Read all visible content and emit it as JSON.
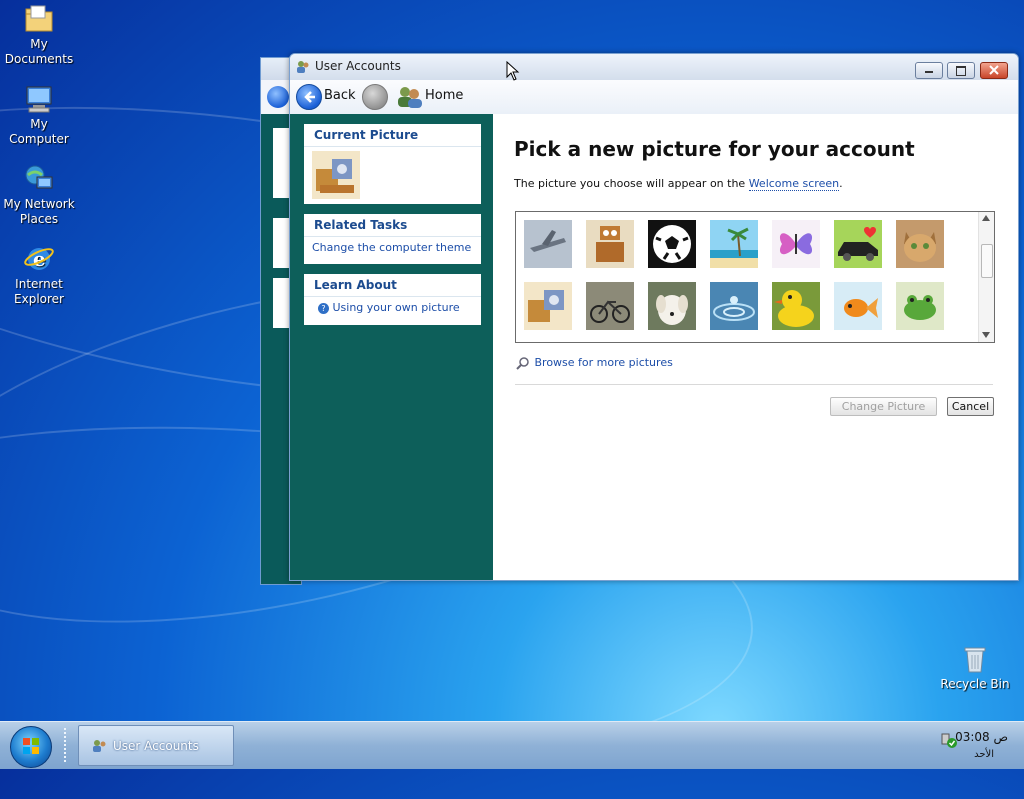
{
  "desktop": {
    "icons": [
      {
        "label_line1": "My",
        "label_line2": "Documents"
      },
      {
        "label_line1": "My Computer",
        "label_line2": ""
      },
      {
        "label_line1": "My Network",
        "label_line2": "Places"
      },
      {
        "label_line1": "Internet",
        "label_line2": "Explorer"
      },
      {
        "label_line1": "Recycle Bin",
        "label_line2": ""
      }
    ]
  },
  "window": {
    "title": "User Accounts",
    "toolbar": {
      "back_label": "Back",
      "home_label": "Home"
    },
    "sidebar": {
      "current_picture_heading": "Current Picture",
      "related_tasks_heading": "Related Tasks",
      "related_tasks_link": "Change the computer theme",
      "learn_about_heading": "Learn About",
      "learn_about_link": "Using your own picture"
    },
    "content": {
      "heading": "Pick a new picture for your account",
      "description_prefix": "The picture you choose will appear on the ",
      "description_link": "Welcome screen",
      "description_suffix": ".",
      "pictures": [
        "airplane",
        "robot",
        "soccer-ball",
        "beach",
        "butterfly",
        "car",
        "kitten",
        "robot-toy",
        "bicycle",
        "puppy",
        "water-drop",
        "rubber-duck",
        "goldfish",
        "frog"
      ],
      "browse_link": "Browse for more pictures",
      "change_button": "Change Picture",
      "cancel_button": "Cancel"
    }
  },
  "taskbar": {
    "task_label": "User Accounts",
    "clock_time": "03:08 ص",
    "clock_day": "الأحد"
  }
}
